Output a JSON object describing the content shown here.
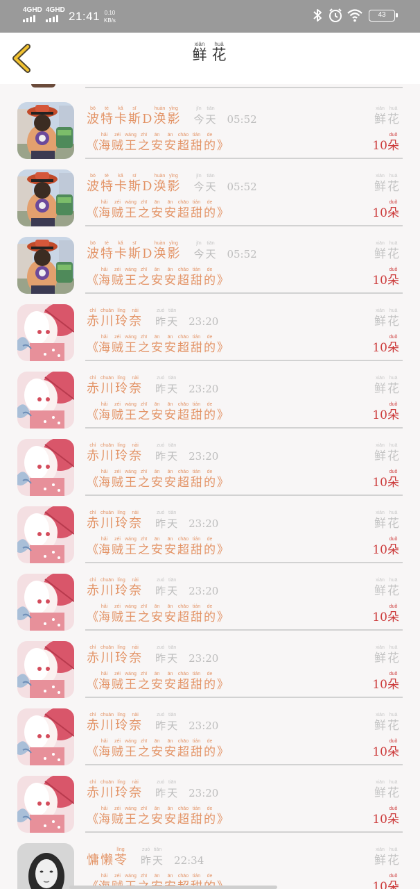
{
  "status_bar": {
    "sim1": "4GHD",
    "sim2": "4GHD",
    "time": "21:41",
    "speed_value": "0.10",
    "speed_unit": "KB/s",
    "battery": "43"
  },
  "header": {
    "title_chars": [
      {
        "py": "xiān",
        "hz": "鲜"
      },
      {
        "py": "huā",
        "hz": "花"
      }
    ]
  },
  "labels": {
    "open_quote": "《",
    "close_quote": "》",
    "count": "10"
  },
  "gift": {
    "tag": [
      {
        "py": "xiān",
        "hz": "鲜"
      },
      {
        "py": "huā",
        "hz": "花"
      }
    ],
    "book": [
      {
        "py": "hǎi",
        "hz": "海"
      },
      {
        "py": "zéi",
        "hz": "贼"
      },
      {
        "py": "wáng",
        "hz": "王"
      },
      {
        "py": "zhī",
        "hz": "之"
      },
      {
        "py": "ān",
        "hz": "安"
      },
      {
        "py": "ān",
        "hz": "安"
      },
      {
        "py": "chāo",
        "hz": "超"
      },
      {
        "py": "tián",
        "hz": "甜"
      },
      {
        "py": "de",
        "hz": "的"
      }
    ],
    "unit": {
      "py": "duǒ",
      "hz": "朵"
    }
  },
  "items": [
    {
      "avatar": "ace",
      "name": [
        {
          "py": "bō",
          "hz": "波"
        },
        {
          "py": "tè",
          "hz": "特"
        },
        {
          "py": "kǎ",
          "hz": "卡"
        },
        {
          "py": "sī",
          "hz": "斯"
        },
        {
          "py": "",
          "hz": "D"
        },
        {
          "py": "huàn",
          "hz": "涣"
        },
        {
          "py": "yǐng",
          "hz": "影"
        }
      ],
      "day": [
        {
          "py": "jīn",
          "hz": "今"
        },
        {
          "py": "tiān",
          "hz": "天"
        }
      ],
      "time": "05:52"
    },
    {
      "avatar": "ace",
      "name": [
        {
          "py": "bō",
          "hz": "波"
        },
        {
          "py": "tè",
          "hz": "特"
        },
        {
          "py": "kǎ",
          "hz": "卡"
        },
        {
          "py": "sī",
          "hz": "斯"
        },
        {
          "py": "",
          "hz": "D"
        },
        {
          "py": "huàn",
          "hz": "涣"
        },
        {
          "py": "yǐng",
          "hz": "影"
        }
      ],
      "day": [
        {
          "py": "jīn",
          "hz": "今"
        },
        {
          "py": "tiān",
          "hz": "天"
        }
      ],
      "time": "05:52"
    },
    {
      "avatar": "ace",
      "name": [
        {
          "py": "bō",
          "hz": "波"
        },
        {
          "py": "tè",
          "hz": "特"
        },
        {
          "py": "kǎ",
          "hz": "卡"
        },
        {
          "py": "sī",
          "hz": "斯"
        },
        {
          "py": "",
          "hz": "D"
        },
        {
          "py": "huàn",
          "hz": "涣"
        },
        {
          "py": "yǐng",
          "hz": "影"
        }
      ],
      "day": [
        {
          "py": "jīn",
          "hz": "今"
        },
        {
          "py": "tiān",
          "hz": "天"
        }
      ],
      "time": "05:52"
    },
    {
      "avatar": "anime",
      "name": [
        {
          "py": "chì",
          "hz": "赤"
        },
        {
          "py": "chuān",
          "hz": "川"
        },
        {
          "py": "líng",
          "hz": "玲"
        },
        {
          "py": "nài",
          "hz": "奈"
        }
      ],
      "day": [
        {
          "py": "zuó",
          "hz": "昨"
        },
        {
          "py": "tiān",
          "hz": "天"
        }
      ],
      "time": "23:20"
    },
    {
      "avatar": "anime",
      "name": [
        {
          "py": "chì",
          "hz": "赤"
        },
        {
          "py": "chuān",
          "hz": "川"
        },
        {
          "py": "líng",
          "hz": "玲"
        },
        {
          "py": "nài",
          "hz": "奈"
        }
      ],
      "day": [
        {
          "py": "zuó",
          "hz": "昨"
        },
        {
          "py": "tiān",
          "hz": "天"
        }
      ],
      "time": "23:20"
    },
    {
      "avatar": "anime",
      "name": [
        {
          "py": "chì",
          "hz": "赤"
        },
        {
          "py": "chuān",
          "hz": "川"
        },
        {
          "py": "líng",
          "hz": "玲"
        },
        {
          "py": "nài",
          "hz": "奈"
        }
      ],
      "day": [
        {
          "py": "zuó",
          "hz": "昨"
        },
        {
          "py": "tiān",
          "hz": "天"
        }
      ],
      "time": "23:20"
    },
    {
      "avatar": "anime",
      "name": [
        {
          "py": "chì",
          "hz": "赤"
        },
        {
          "py": "chuān",
          "hz": "川"
        },
        {
          "py": "líng",
          "hz": "玲"
        },
        {
          "py": "nài",
          "hz": "奈"
        }
      ],
      "day": [
        {
          "py": "zuó",
          "hz": "昨"
        },
        {
          "py": "tiān",
          "hz": "天"
        }
      ],
      "time": "23:20"
    },
    {
      "avatar": "anime",
      "name": [
        {
          "py": "chì",
          "hz": "赤"
        },
        {
          "py": "chuān",
          "hz": "川"
        },
        {
          "py": "líng",
          "hz": "玲"
        },
        {
          "py": "nài",
          "hz": "奈"
        }
      ],
      "day": [
        {
          "py": "zuó",
          "hz": "昨"
        },
        {
          "py": "tiān",
          "hz": "天"
        }
      ],
      "time": "23:20"
    },
    {
      "avatar": "anime",
      "name": [
        {
          "py": "chì",
          "hz": "赤"
        },
        {
          "py": "chuān",
          "hz": "川"
        },
        {
          "py": "líng",
          "hz": "玲"
        },
        {
          "py": "nài",
          "hz": "奈"
        }
      ],
      "day": [
        {
          "py": "zuó",
          "hz": "昨"
        },
        {
          "py": "tiān",
          "hz": "天"
        }
      ],
      "time": "23:20"
    },
    {
      "avatar": "anime",
      "name": [
        {
          "py": "chì",
          "hz": "赤"
        },
        {
          "py": "chuān",
          "hz": "川"
        },
        {
          "py": "líng",
          "hz": "玲"
        },
        {
          "py": "nài",
          "hz": "奈"
        }
      ],
      "day": [
        {
          "py": "zuó",
          "hz": "昨"
        },
        {
          "py": "tiān",
          "hz": "天"
        }
      ],
      "time": "23:20"
    },
    {
      "avatar": "anime",
      "name": [
        {
          "py": "chì",
          "hz": "赤"
        },
        {
          "py": "chuān",
          "hz": "川"
        },
        {
          "py": "líng",
          "hz": "玲"
        },
        {
          "py": "nài",
          "hz": "奈"
        }
      ],
      "day": [
        {
          "py": "zuó",
          "hz": "昨"
        },
        {
          "py": "tiān",
          "hz": "天"
        }
      ],
      "time": "23:20"
    },
    {
      "avatar": "photo",
      "name": [
        {
          "py": "",
          "hz": "慵"
        },
        {
          "py": "",
          "hz": "懒"
        },
        {
          "py": "líng",
          "hz": "苓"
        }
      ],
      "day": [
        {
          "py": "zuó",
          "hz": "昨"
        },
        {
          "py": "tiān",
          "hz": "天"
        }
      ],
      "time": "22:34"
    }
  ]
}
